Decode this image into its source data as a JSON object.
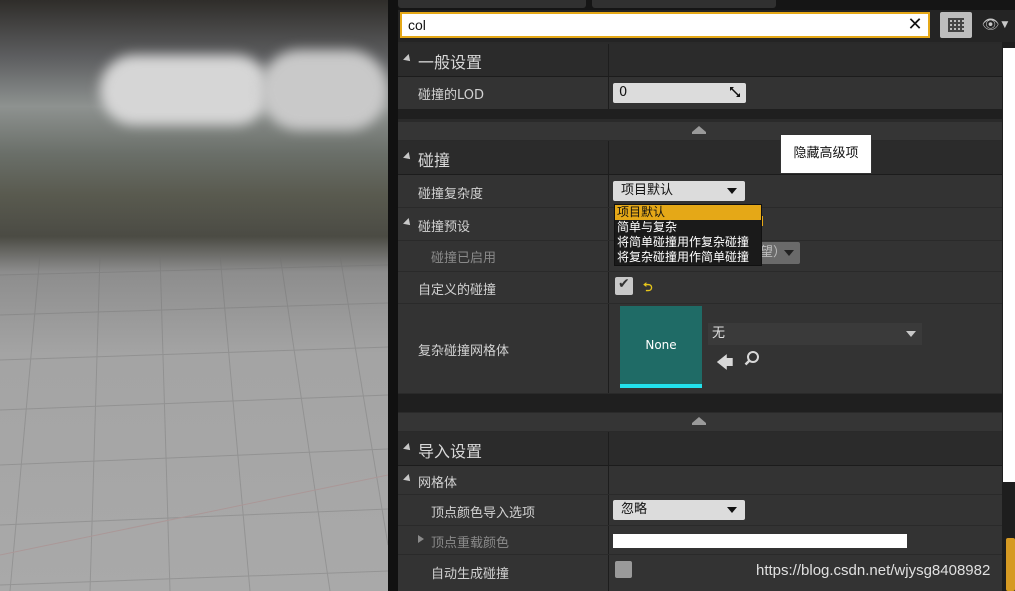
{
  "search": {
    "value": "col"
  },
  "categories": {
    "general": {
      "label": "一般设置"
    },
    "collision": {
      "label": "碰撞"
    },
    "import": {
      "label": "导入设置"
    }
  },
  "properties": {
    "collision_lod": {
      "label": "碰撞的LOD",
      "value": "0"
    },
    "collision_complexity": {
      "label": "碰撞复杂度",
      "value": "项目默认"
    },
    "collision_presets": {
      "label": "碰撞预设"
    },
    "collision_enabled": {
      "label": "碰撞已启用",
      "partial_value": "望）"
    },
    "custom_collision": {
      "label": "自定义的碰撞",
      "reset_glyph": "⮌"
    },
    "complex_collision_mesh": {
      "label": "复杂碰撞网格体",
      "thumb_text": "None",
      "asset_value": "无"
    },
    "mesh_group": {
      "label": "网格体"
    },
    "vertex_color_import": {
      "label": "顶点颜色导入选项",
      "value": "忽略"
    },
    "vertex_override_color": {
      "label": "顶点重载颜色"
    },
    "auto_generate_collision": {
      "label": "自动生成碰撞"
    }
  },
  "dropdown_options": [
    "项目默认",
    "简单与复杂",
    "将简单碰撞用作复杂碰撞",
    "将复杂碰撞用作简单碰撞"
  ],
  "tooltip": {
    "text": "隐藏高级项"
  },
  "watermark": {
    "text": "https://blog.csdn.net/wjysg8408982"
  },
  "colors": {
    "accent": "#e5a817",
    "thumb_bg": "#1f6b66",
    "thumb_bar": "#22e1ec"
  }
}
